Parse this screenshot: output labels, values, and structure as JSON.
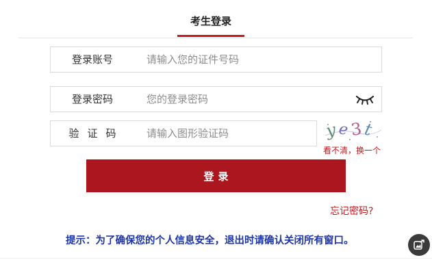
{
  "tab": {
    "label": "考生登录"
  },
  "account": {
    "label": "登录账号",
    "placeholder": "请输入您的证件号码"
  },
  "password": {
    "label": "登录密码",
    "placeholder": "您的登录密码",
    "toggle_icon": "closed-eye-icon"
  },
  "captcha": {
    "label": "验证码",
    "placeholder": "请输入图形验证码",
    "image_text": "ye3t",
    "refresh_label": "看不清，换一个"
  },
  "login_button": {
    "label": "登录"
  },
  "forgot_link": {
    "label": "忘记密码?"
  },
  "tip": {
    "text": "提示：为了确保您的个人信息安全，退出时请确认关闭所有窗口。"
  },
  "floating_button": {
    "icon": "image-share-icon"
  },
  "colors": {
    "accent": "#c8161d",
    "button": "#ac161e",
    "tip": "#1d35a8"
  }
}
